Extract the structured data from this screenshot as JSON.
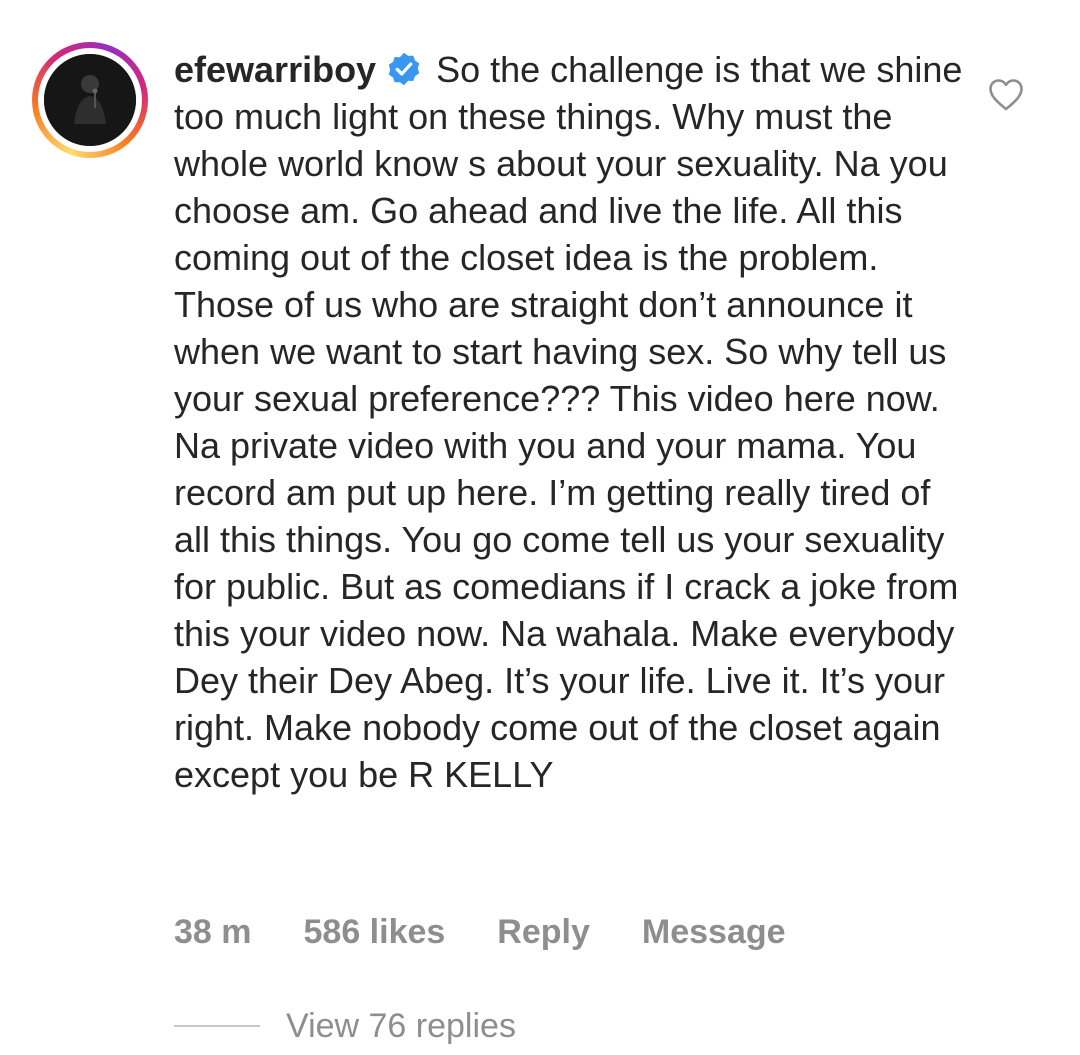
{
  "comment": {
    "username": "efewarriboy",
    "text": "So the challenge is that we shine too much light on these things. Why must the whole world know s about your sexuality. Na you choose am. Go ahead and live the life. All this coming out of the closet idea is the problem. Those of us who are straight don’t announce it when we want to start having sex. So why tell us your sexual preference??? This video here now. Na private video with you and your mama.  You record am put up here. I’m getting really tired of all this things. You go come tell us your sexuality for public. But as comedians if I crack a joke from this your video now. Na wahala. Make everybody Dey their Dey Abeg. It’s your life. Live it. It’s your right. Make nobody come out of the closet again except you be R KELLY",
    "verified_icon": "verified-badge-icon",
    "like_icon": "heart-outline-icon"
  },
  "meta": {
    "time": "38 m",
    "likes": "586 likes",
    "reply": "Reply",
    "message": "Message"
  },
  "replies": {
    "label": "View 76 replies"
  },
  "colors": {
    "text": "#262626",
    "muted": "#8e8e8e",
    "verified": "#3897f0",
    "story_ring_start": "#feda75",
    "story_ring_end": "#962fbf"
  }
}
